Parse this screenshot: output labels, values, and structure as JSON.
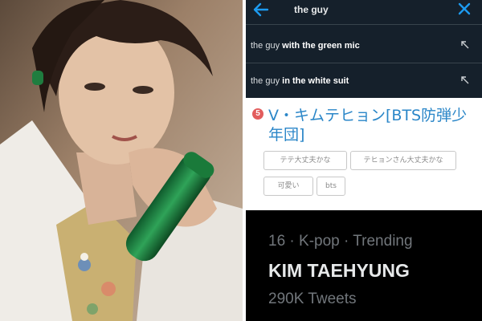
{
  "search": {
    "query": "the guy",
    "suggestions": [
      {
        "prefix": "the guy",
        "rest": "with the green mic"
      },
      {
        "prefix": "the guy",
        "rest": "in the white suit"
      }
    ]
  },
  "jp_result": {
    "rank": "5",
    "title": "V・キムテヒョン[BTS防弾少年団]",
    "tags": [
      "テテ大丈夫かな",
      "テヒョンさん大丈夫かな",
      "可愛い",
      "bts"
    ]
  },
  "trend": {
    "meta": "16 · K-pop · Trending",
    "name": "KIM TAEHYUNG",
    "count": "290K Tweets"
  },
  "colors": {
    "dark_bg": "#15202b",
    "link_blue": "#2a86c8",
    "badge_red": "#e25d5d",
    "icon_blue": "#1d9bf0"
  },
  "icons": [
    "back-arrow-icon",
    "close-icon",
    "north-west-arrow-icon"
  ]
}
